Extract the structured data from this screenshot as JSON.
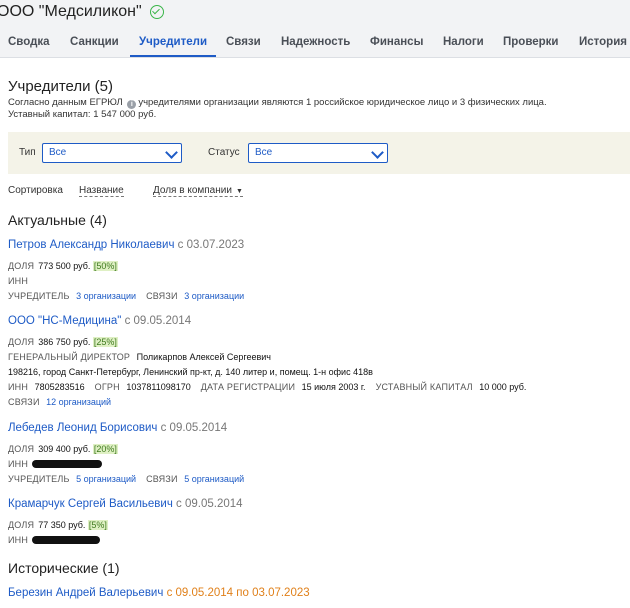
{
  "header": {
    "company_name": "ООО \"Медсиликон\""
  },
  "tabs": [
    {
      "label": "Сводка"
    },
    {
      "label": "Санкции"
    },
    {
      "label": "Учредители"
    },
    {
      "label": "Связи"
    },
    {
      "label": "Надежность"
    },
    {
      "label": "Финансы"
    },
    {
      "label": "Налоги"
    },
    {
      "label": "Проверки"
    },
    {
      "label": "История"
    }
  ],
  "active_tab": "Учредители",
  "colors": {
    "accent": "#1e5bc6",
    "verified": "#3bb54a",
    "historic": "#e0801a",
    "share_bg": "#dff0c4"
  },
  "section": {
    "title": "Учредители (5)",
    "desc_prefix": "Согласно данным ЕГРЮЛ",
    "desc_suffix": "учредителями организации являются 1 российское юридическое лицо и 3 физических лица.",
    "capital": "Уставный капитал: 1 547 000 руб."
  },
  "filters": {
    "type_label": "Тип",
    "type_value": "Все",
    "status_label": "Статус",
    "status_value": "Все"
  },
  "sort": {
    "label": "Сортировка",
    "by_name": "Название",
    "by_share": "Доля в компании"
  },
  "current": {
    "title": "Актуальные (4)",
    "founders": [
      {
        "name": "Петров Александр Николаевич",
        "since": "с 03.07.2023",
        "share_label": "ДОЛЯ",
        "share_value": "773 500 руб.",
        "share_pct": "[50%]",
        "inn_label": "ИНН",
        "founder_label": "УЧРЕДИТЕЛЬ",
        "founder_link": "3 организации",
        "links_label": "СВЯЗИ",
        "links_link": "3 организации"
      },
      {
        "name": "ООО \"НС-Медицина\"",
        "since": "с 09.05.2014",
        "share_label": "ДОЛЯ",
        "share_value": "386 750 руб.",
        "share_pct": "[25%]",
        "director_label": "ГЕНЕРАЛЬНЫЙ ДИРЕКТОР",
        "director_name": "Поликарпов Алексей Сергеевич",
        "address": "198216, город Санкт-Петербург, Ленинский пр-кт, д. 140 литер и, помещ. 1-н офис 418в",
        "inn_label": "ИНН",
        "inn_value": "7805283516",
        "ogrn_label": "ОГРН",
        "ogrn_value": "1037811098170",
        "reg_label": "ДАТА РЕГИСТРАЦИИ",
        "reg_value": "15 июля 2003 г.",
        "capital_label": "УСТАВНЫЙ КАПИТАЛ",
        "capital_value": "10 000 руб.",
        "links_label": "СВЯЗИ",
        "links_link": "12 организаций"
      },
      {
        "name": "Лебедев Леонид Борисович",
        "since": "с 09.05.2014",
        "share_label": "ДОЛЯ",
        "share_value": "309 400 руб.",
        "share_pct": "[20%]",
        "inn_label": "ИНН",
        "founder_label": "УЧРЕДИТЕЛЬ",
        "founder_link": "5 организаций",
        "links_label": "СВЯЗИ",
        "links_link": "5 организаций"
      },
      {
        "name": "Крамарчук Сергей Васильевич",
        "since": "с 09.05.2014",
        "share_label": "ДОЛЯ",
        "share_value": "77 350 руб.",
        "share_pct": "[5%]",
        "inn_label": "ИНН"
      }
    ]
  },
  "historic": {
    "title": "Исторические (1)",
    "founders": [
      {
        "name": "Березин Андрей Валерьевич",
        "dates": "с 09.05.2014 по 03.07.2023"
      }
    ]
  }
}
